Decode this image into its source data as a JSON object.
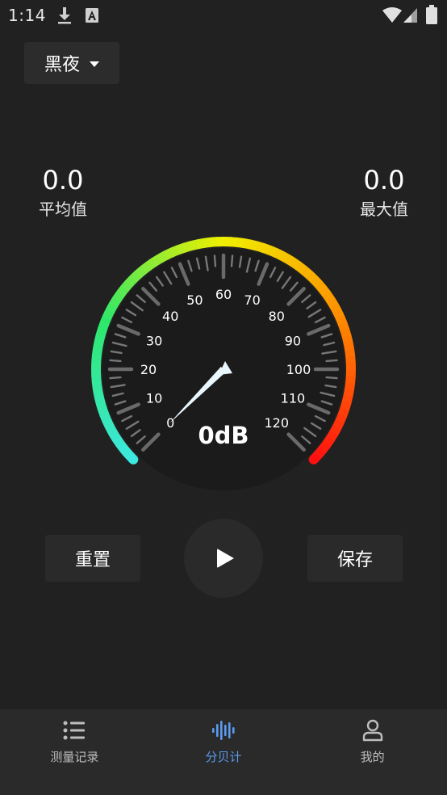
{
  "status_bar": {
    "time": "1:14",
    "icons": [
      "download-icon",
      "font-icon",
      "wifi-icon",
      "signal-icon",
      "battery-icon"
    ]
  },
  "theme": {
    "label": "黑夜",
    "icon": "dropdown-caret-icon"
  },
  "stats": {
    "average": {
      "value": "0.0",
      "label": "平均值"
    },
    "maximum": {
      "value": "0.0",
      "label": "最大值"
    }
  },
  "gauge": {
    "reading": "0dB",
    "value": 0,
    "min": 0,
    "max": 120,
    "scale_labels": [
      "0",
      "10",
      "20",
      "30",
      "40",
      "50",
      "60",
      "70",
      "80",
      "90",
      "100",
      "110",
      "120"
    ],
    "gradient_colors": [
      "#3de8e0",
      "#2ee86a",
      "#f0f000",
      "#ff8a00",
      "#ff1010"
    ]
  },
  "controls": {
    "reset_label": "重置",
    "play_icon": "play-icon",
    "save_label": "保存"
  },
  "nav": {
    "items": [
      {
        "label": "测量记录",
        "icon": "list-icon",
        "active": false
      },
      {
        "label": "分贝计",
        "icon": "sound-wave-icon",
        "active": true
      },
      {
        "label": "我的",
        "icon": "person-icon",
        "active": false
      }
    ],
    "active_color": "#5b9bf0"
  }
}
